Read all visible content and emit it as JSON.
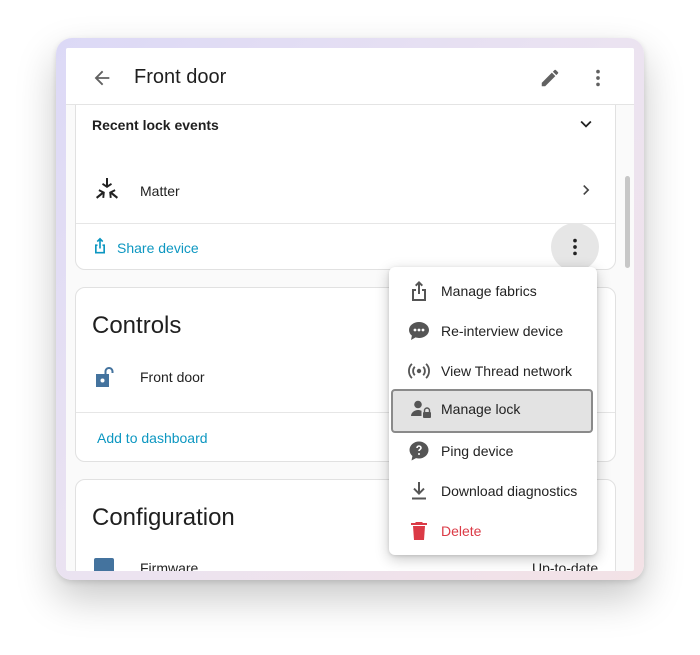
{
  "header": {
    "title": "Front door",
    "back_icon": "arrow-left-icon",
    "edit_icon": "pencil-icon",
    "more_icon": "dots-vertical-icon"
  },
  "device_card": {
    "recent_events_label": "Recent lock events",
    "integration_name": "Matter",
    "share_label": "Share device",
    "accent_color": "#0d97c1"
  },
  "controls_card": {
    "title": "Controls",
    "entity_name": "Front door",
    "add_dashboard_label": "Add to dashboard"
  },
  "config_card": {
    "title": "Configuration",
    "firmware_label": "Firmware",
    "firmware_value": "Up-to-date"
  },
  "menu": {
    "items": [
      {
        "label": "Manage fabrics",
        "icon": "share-icon"
      },
      {
        "label": "Re-interview device",
        "icon": "chat-dots-icon"
      },
      {
        "label": "View Thread network",
        "icon": "broadcast-icon"
      },
      {
        "label": "Manage lock",
        "icon": "account-lock-icon"
      },
      {
        "label": "Ping device",
        "icon": "help-bubble-icon"
      },
      {
        "label": "Download diagnostics",
        "icon": "download-icon"
      },
      {
        "label": "Delete",
        "icon": "trash-icon"
      }
    ],
    "selected_index": 3,
    "delete_color": "#db4437"
  }
}
